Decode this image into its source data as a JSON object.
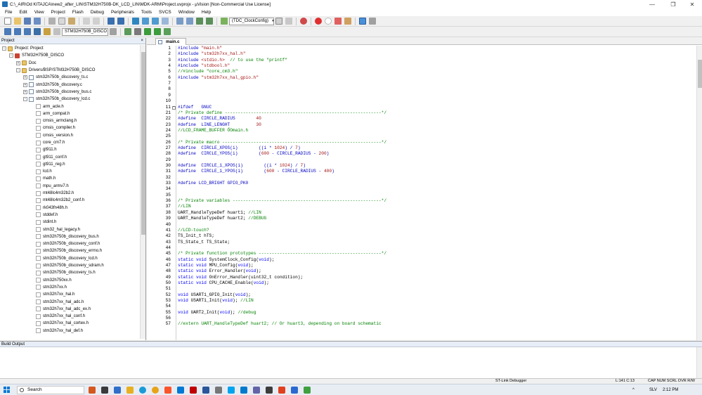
{
  "window": {
    "title": "C:\\_AIR\\Od KITAJCA\\new2_after_LIN\\STM32H750B-DK_LCD_LIN\\MDK-ARM\\Project.uvprojx - µVision  [Non-Commercial Use License]",
    "minimize": "—",
    "maximize": "❐",
    "close": "✕"
  },
  "menu": [
    "File",
    "Edit",
    "View",
    "Project",
    "Flash",
    "Debug",
    "Peripherals",
    "Tools",
    "SVCS",
    "Window",
    "Help"
  ],
  "toolbar": {
    "function_combo": "(TDC_ClockConfig)",
    "target_combo": "STM32H750B_DISCO"
  },
  "project_panel": {
    "header": "Project",
    "close": "×",
    "tree": [
      {
        "level": 0,
        "exp": "-",
        "icon": "folder",
        "label": "Project: Project"
      },
      {
        "level": 1,
        "exp": "-",
        "icon": "proj",
        "label": "STM32H750B_DISCO"
      },
      {
        "level": 2,
        "exp": "+",
        "icon": "folder",
        "label": "Doc"
      },
      {
        "level": 2,
        "exp": "-",
        "icon": "folder",
        "label": "Drivers/BSP/STM32H750B_DISCO"
      },
      {
        "level": 3,
        "exp": "+",
        "icon": "file",
        "label": "stm32h750b_discovery_ts.c"
      },
      {
        "level": 3,
        "exp": "+",
        "icon": "file",
        "label": "stm32h750b_discovery.c"
      },
      {
        "level": 3,
        "exp": "+",
        "icon": "file",
        "label": "stm32h750b_discovery_bus.c"
      },
      {
        "level": 3,
        "exp": "-",
        "icon": "file",
        "label": "stm32h750b_discovery_lcd.c"
      },
      {
        "level": 4,
        "exp": "",
        "icon": "hfile",
        "label": "arm_acle.h"
      },
      {
        "level": 4,
        "exp": "",
        "icon": "hfile",
        "label": "arm_compat.h"
      },
      {
        "level": 4,
        "exp": "",
        "icon": "hfile",
        "label": "cmsis_armclang.h"
      },
      {
        "level": 4,
        "exp": "",
        "icon": "hfile",
        "label": "cmsis_compiler.h"
      },
      {
        "level": 4,
        "exp": "",
        "icon": "hfile",
        "label": "cmsis_version.h"
      },
      {
        "level": 4,
        "exp": "",
        "icon": "hfile",
        "label": "core_cm7.h"
      },
      {
        "level": 4,
        "exp": "",
        "icon": "hfile",
        "label": "gt911.h"
      },
      {
        "level": 4,
        "exp": "",
        "icon": "hfile",
        "label": "gt911_conf.h"
      },
      {
        "level": 4,
        "exp": "",
        "icon": "hfile",
        "label": "gt911_reg.h"
      },
      {
        "level": 4,
        "exp": "",
        "icon": "hfile",
        "label": "lcd.h"
      },
      {
        "level": 4,
        "exp": "",
        "icon": "hfile",
        "label": "math.h"
      },
      {
        "level": 4,
        "exp": "",
        "icon": "hfile",
        "label": "mpu_armv7.h"
      },
      {
        "level": 4,
        "exp": "",
        "icon": "hfile",
        "label": "mt48lc4m32b2.h"
      },
      {
        "level": 4,
        "exp": "",
        "icon": "hfile",
        "label": "mt48lc4m32b2_conf.h"
      },
      {
        "level": 4,
        "exp": "",
        "icon": "hfile",
        "label": "rk043fn48h.h"
      },
      {
        "level": 4,
        "exp": "",
        "icon": "hfile",
        "label": "stddef.h"
      },
      {
        "level": 4,
        "exp": "",
        "icon": "hfile",
        "label": "stdint.h"
      },
      {
        "level": 4,
        "exp": "",
        "icon": "hfile",
        "label": "stm32_hal_legacy.h"
      },
      {
        "level": 4,
        "exp": "",
        "icon": "hfile",
        "label": "stm32h750b_discovery_bus.h"
      },
      {
        "level": 4,
        "exp": "",
        "icon": "hfile",
        "label": "stm32h750b_discovery_conf.h"
      },
      {
        "level": 4,
        "exp": "",
        "icon": "hfile",
        "label": "stm32h750b_discovery_errno.h"
      },
      {
        "level": 4,
        "exp": "",
        "icon": "hfile",
        "label": "stm32h750b_discovery_lcd.h"
      },
      {
        "level": 4,
        "exp": "",
        "icon": "hfile",
        "label": "stm32h750b_discovery_sdram.h"
      },
      {
        "level": 4,
        "exp": "",
        "icon": "hfile",
        "label": "stm32h750b_discovery_ts.h"
      },
      {
        "level": 4,
        "exp": "",
        "icon": "hfile",
        "label": "stm32h750xx.h"
      },
      {
        "level": 4,
        "exp": "",
        "icon": "hfile",
        "label": "stm32h7xx.h"
      },
      {
        "level": 4,
        "exp": "",
        "icon": "hfile",
        "label": "stm32h7xx_hal.h"
      },
      {
        "level": 4,
        "exp": "",
        "icon": "hfile",
        "label": "stm32h7xx_hal_adc.h"
      },
      {
        "level": 4,
        "exp": "",
        "icon": "hfile",
        "label": "stm32h7xx_hal_adc_ex.h"
      },
      {
        "level": 4,
        "exp": "",
        "icon": "hfile",
        "label": "stm32h7xx_hal_conf.h"
      },
      {
        "level": 4,
        "exp": "",
        "icon": "hfile",
        "label": "stm32h7xx_hal_cortex.h"
      },
      {
        "level": 4,
        "exp": "",
        "icon": "hfile",
        "label": "stm32h7xx_hal_def.h"
      }
    ]
  },
  "editor": {
    "tab": "main.c",
    "lines": [
      {
        "n": "1",
        "fold": "",
        "segs": [
          [
            "pp",
            "#include "
          ],
          [
            "str",
            "\"main.h\""
          ]
        ]
      },
      {
        "n": "2",
        "fold": "",
        "segs": [
          [
            "pp",
            "#include "
          ],
          [
            "str",
            "\"stm32h7xx_hal.h\""
          ]
        ]
      },
      {
        "n": "3",
        "fold": "",
        "segs": [
          [
            "pp",
            "#include "
          ],
          [
            "str",
            "<stdio.h>"
          ],
          [
            "cmt",
            "  // to use the \"printf\""
          ]
        ]
      },
      {
        "n": "4",
        "fold": "",
        "segs": [
          [
            "pp",
            "#include "
          ],
          [
            "str",
            "\"stdbool.h\""
          ]
        ]
      },
      {
        "n": "5",
        "fold": "",
        "segs": [
          [
            "cmt",
            "//#include \"core_cm3.h\""
          ]
        ]
      },
      {
        "n": "6",
        "fold": "",
        "segs": [
          [
            "pp",
            "#include "
          ],
          [
            "str",
            "\"stm32h7xx_hal_gpio.h\""
          ]
        ]
      },
      {
        "n": "7",
        "fold": "",
        "segs": []
      },
      {
        "n": "8",
        "fold": "",
        "segs": []
      },
      {
        "n": "9",
        "fold": "",
        "segs": []
      },
      {
        "n": "10",
        "fold": "",
        "segs": []
      },
      {
        "n": "11",
        "fold": "+",
        "segs": [
          [
            "pp",
            "#ifdef   GNUC"
          ]
        ]
      },
      {
        "n": "21",
        "fold": "",
        "segs": [
          [
            "cmt",
            "/* Private define ------------------------------------------------------------*/"
          ]
        ]
      },
      {
        "n": "22",
        "fold": "",
        "segs": [
          [
            "pp",
            "#define  CIRCLE_RADIUS        "
          ],
          [
            "num",
            "40"
          ]
        ]
      },
      {
        "n": "23",
        "fold": "",
        "segs": [
          [
            "pp",
            "#define  LINE_LENGHT          "
          ],
          [
            "num",
            "30"
          ]
        ]
      },
      {
        "n": "24",
        "fold": "",
        "segs": [
          [
            "cmt",
            "//LCD_FRAME_BUFFER ŐOmain.h"
          ]
        ]
      },
      {
        "n": "25",
        "fold": "",
        "segs": []
      },
      {
        "n": "26",
        "fold": "",
        "segs": [
          [
            "cmt",
            "/* Private macro -------------------------------------------------------------*/"
          ]
        ]
      },
      {
        "n": "27",
        "fold": "",
        "segs": [
          [
            "pp",
            "#define  CIRCLE_XPOS(i)        ((i * "
          ],
          [
            "num",
            "1024"
          ],
          [
            "pp",
            ") / "
          ],
          [
            "num",
            "7"
          ],
          [
            "pp",
            ")"
          ]
        ]
      },
      {
        "n": "28",
        "fold": "",
        "segs": [
          [
            "pp",
            "#define  CIRCLE_YPOS(i)        ("
          ],
          [
            "num",
            "600"
          ],
          [
            "pp",
            " - CIRCLE_RADIUS - "
          ],
          [
            "num",
            "200"
          ],
          [
            "pp",
            ")"
          ]
        ]
      },
      {
        "n": "29",
        "fold": "",
        "segs": []
      },
      {
        "n": "30",
        "fold": "",
        "segs": [
          [
            "pp",
            "#define  CIRCLE_1_XPOS(i)        ((i * "
          ],
          [
            "num",
            "1024"
          ],
          [
            "pp",
            ") / "
          ],
          [
            "num",
            "7"
          ],
          [
            "pp",
            ")"
          ]
        ]
      },
      {
        "n": "31",
        "fold": "",
        "segs": [
          [
            "pp",
            "#define  CIRCLE_1_YPOS(i)        ("
          ],
          [
            "num",
            "600"
          ],
          [
            "pp",
            " - CIRCLE_RADIUS - "
          ],
          [
            "num",
            "400"
          ],
          [
            "pp",
            ")"
          ]
        ]
      },
      {
        "n": "32",
        "fold": "",
        "segs": []
      },
      {
        "n": "33",
        "fold": "",
        "segs": [
          [
            "pp",
            "#define LCD_BRIGHT GPIO_PK0"
          ]
        ]
      },
      {
        "n": "34",
        "fold": "",
        "segs": []
      },
      {
        "n": "35",
        "fold": "",
        "segs": []
      },
      {
        "n": "36",
        "fold": "",
        "segs": [
          [
            "cmt",
            "/* Private variables ---------------------------------------------------------*/"
          ]
        ]
      },
      {
        "n": "37",
        "fold": "",
        "segs": [
          [
            "cmt",
            "//LIN"
          ]
        ]
      },
      {
        "n": "38",
        "fold": "",
        "segs": [
          [
            "",
            "UART_HandleTypeDef huart1; "
          ],
          [
            "cmt",
            "//LIN"
          ]
        ]
      },
      {
        "n": "39",
        "fold": "",
        "segs": [
          [
            "",
            "UART_HandleTypeDef huart2; "
          ],
          [
            "cmt",
            "//DEBUG"
          ]
        ]
      },
      {
        "n": "40",
        "fold": "",
        "segs": []
      },
      {
        "n": "41",
        "fold": "",
        "segs": [
          [
            "cmt",
            "//LCD-touch?"
          ]
        ]
      },
      {
        "n": "42",
        "fold": "",
        "segs": [
          [
            "",
            "TS_Init_t hTS;"
          ]
        ]
      },
      {
        "n": "43",
        "fold": "",
        "segs": [
          [
            "",
            "TS_State_t TS_State;"
          ]
        ]
      },
      {
        "n": "44",
        "fold": "",
        "segs": []
      },
      {
        "n": "45",
        "fold": "",
        "segs": [
          [
            "cmt",
            "/* Private function prototypes -----------------------------------------------*/"
          ]
        ]
      },
      {
        "n": "46",
        "fold": "",
        "segs": [
          [
            "kw",
            "static void "
          ],
          [
            "",
            "SystemClock_Config("
          ],
          [
            "kw",
            "void"
          ],
          [
            "",
            ");"
          ]
        ]
      },
      {
        "n": "47",
        "fold": "",
        "segs": [
          [
            "kw",
            "static void "
          ],
          [
            "",
            "MPU_Config("
          ],
          [
            "kw",
            "void"
          ],
          [
            "",
            ");"
          ]
        ]
      },
      {
        "n": "48",
        "fold": "",
        "segs": [
          [
            "kw",
            "static void "
          ],
          [
            "",
            "Error_Handler("
          ],
          [
            "kw",
            "void"
          ],
          [
            "",
            ");"
          ]
        ]
      },
      {
        "n": "49",
        "fold": "",
        "segs": [
          [
            "kw",
            "static void "
          ],
          [
            "",
            "OnError_Handler(uint32_t condition);"
          ]
        ]
      },
      {
        "n": "50",
        "fold": "",
        "segs": [
          [
            "kw",
            "static void "
          ],
          [
            "",
            "CPU_CACHE_Enable("
          ],
          [
            "kw",
            "void"
          ],
          [
            "",
            ");"
          ]
        ]
      },
      {
        "n": "51",
        "fold": "",
        "segs": []
      },
      {
        "n": "52",
        "fold": "",
        "segs": [
          [
            "kw",
            "void "
          ],
          [
            "",
            "USART1_GPIO_Init("
          ],
          [
            "kw",
            "void"
          ],
          [
            "",
            ");"
          ]
        ]
      },
      {
        "n": "53",
        "fold": "",
        "segs": [
          [
            "kw",
            "void "
          ],
          [
            "",
            "USART1_Init("
          ],
          [
            "kw",
            "void"
          ],
          [
            "",
            "); "
          ],
          [
            "cmt",
            "//LIN"
          ]
        ]
      },
      {
        "n": "54",
        "fold": "",
        "segs": []
      },
      {
        "n": "55",
        "fold": "",
        "segs": [
          [
            "kw",
            "void "
          ],
          [
            "",
            "UART2_Init("
          ],
          [
            "kw",
            "void"
          ],
          [
            "",
            "); "
          ],
          [
            "cmt",
            "//debug"
          ]
        ]
      },
      {
        "n": "56",
        "fold": "",
        "segs": []
      },
      {
        "n": "57",
        "fold": "",
        "segs": [
          [
            "cmt",
            "//extern UART_HandleTypeDef huart2; // Or huart3, depending on board schematic"
          ]
        ]
      }
    ]
  },
  "build_output": {
    "header": "Build Output"
  },
  "status": {
    "debugger": "ST-Link Debugger",
    "position": "L:141 C:13",
    "indicators": "CAP  NUM  SCRL  OVR  R/W"
  },
  "taskbar": {
    "search": "Search",
    "lang": "SLV",
    "time": "2:12 PM"
  },
  "colors": {
    "preprocessor": "#0000c0",
    "string": "#a31515",
    "comment": "#008000",
    "keyword": "#0000ff"
  }
}
